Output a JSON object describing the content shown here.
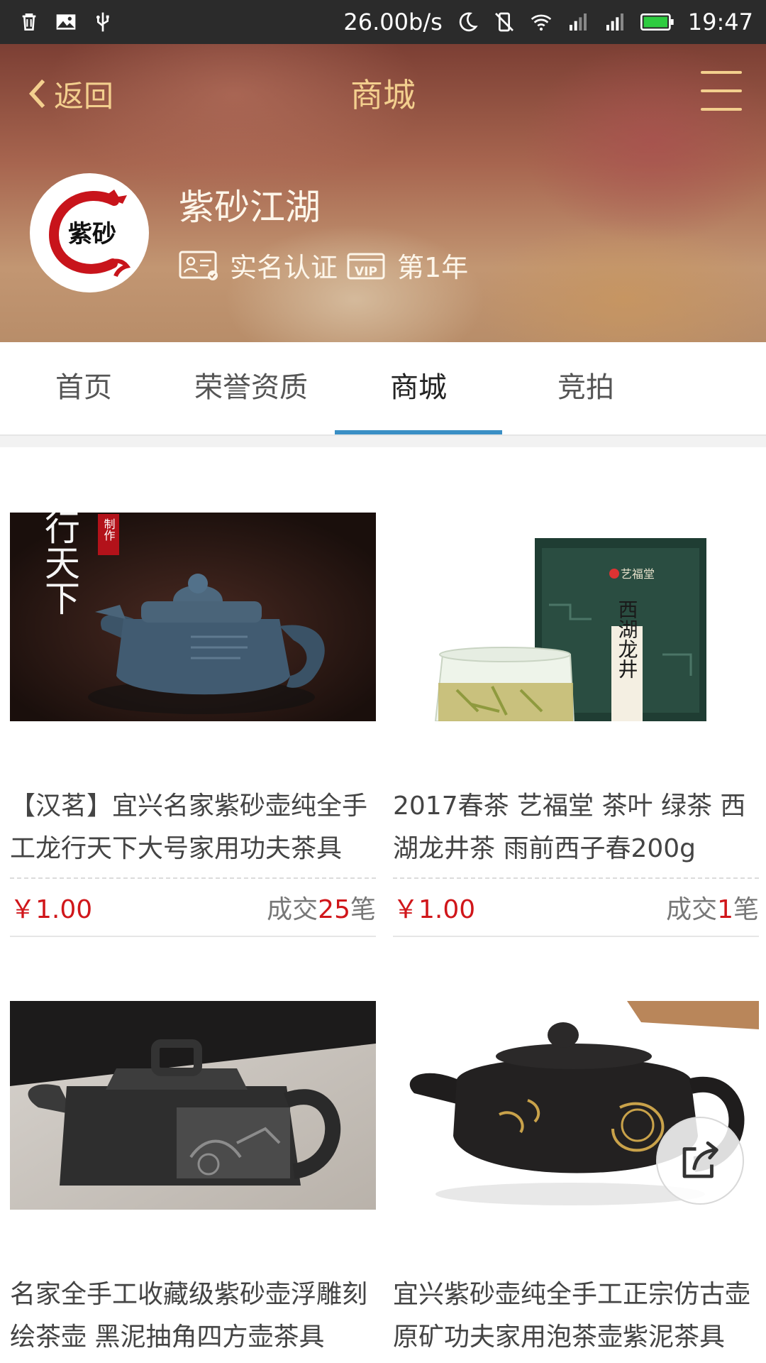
{
  "status_bar": {
    "net_speed": "26.00b/s",
    "time": "19:47"
  },
  "header": {
    "back_label": "返回",
    "title": "商城",
    "shop_name": "紫砂江湖",
    "avatar_text": "紫砂",
    "verify_label": "实名认证",
    "vip_label": "VIP",
    "vip_years": "第1年"
  },
  "tabs": [
    {
      "label": "首页"
    },
    {
      "label": "荣誉资质"
    },
    {
      "label": "商城"
    },
    {
      "label": "竞拍"
    }
  ],
  "active_tab": "商城",
  "products": [
    {
      "title": "【汉茗】宜兴名家紫砂壶纯全手工龙行天下大号家用功夫茶具",
      "price": "￥1.00",
      "sales_prefix": "成交",
      "sales_count": "25",
      "sales_suffix": "笔",
      "image_text": "行天下",
      "image_tag": "制作"
    },
    {
      "title": "2017春茶 艺福堂 茶叶 绿茶 西湖龙井茶 雨前西子春200g",
      "price": "￥1.00",
      "sales_prefix": "成交",
      "sales_count": "1",
      "sales_suffix": "笔",
      "image_text": "西湖龙井",
      "image_brand": "艺福堂"
    },
    {
      "title": "名家全手工收藏级紫砂壶浮雕刻绘茶壶 黑泥抽角四方壶茶具",
      "price": "",
      "sales_prefix": "",
      "sales_count": "",
      "sales_suffix": ""
    },
    {
      "title": "宜兴紫砂壶纯全手工正宗仿古壶原矿功夫家用泡茶壶紫泥茶具",
      "price": "",
      "sales_prefix": "",
      "sales_count": "",
      "sales_suffix": ""
    }
  ],
  "icons": {
    "share": "share-icon",
    "menu": "menu-icon",
    "back": "chevron-left-icon"
  },
  "colors": {
    "header_text": "#f3cf8e",
    "active_tab_indicator": "#3a8fc5",
    "price": "#d0161a"
  }
}
